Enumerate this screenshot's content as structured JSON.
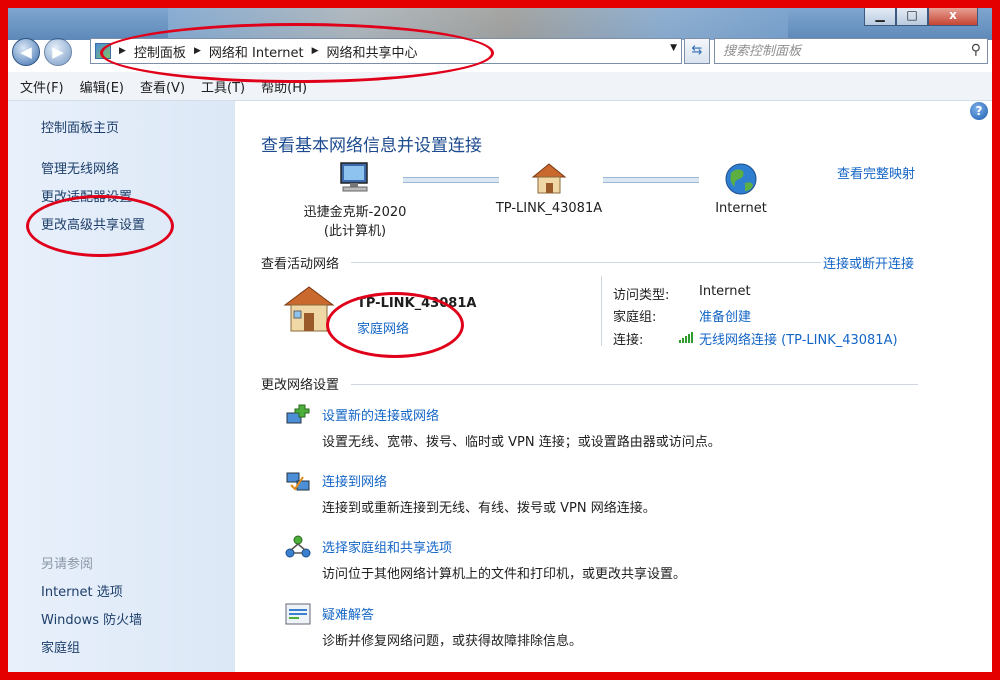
{
  "window": {
    "min_glyph": "▁",
    "max_glyph": "□",
    "close_glyph": "x"
  },
  "nav": {
    "back_glyph": "◀",
    "forward_glyph": "▶",
    "breadcrumb": [
      "控制面板",
      "网络和 Internet",
      "网络和共享中心"
    ],
    "search_placeholder": "搜索控制面板"
  },
  "menu": [
    "文件(F)",
    "编辑(E)",
    "查看(V)",
    "工具(T)",
    "帮助(H)"
  ],
  "sidebar": {
    "items": [
      "控制面板主页",
      "管理无线网络",
      "更改适配器设置",
      "更改高级共享设置"
    ],
    "see_also_title": "另请参阅",
    "see_also": [
      "Internet 选项",
      "Windows 防火墙",
      "家庭组"
    ]
  },
  "main": {
    "title": "查看基本网络信息并设置连接",
    "full_map_link": "查看完整映射",
    "map": [
      {
        "label": "迅捷金克斯-2020",
        "sublabel": "(此计算机)"
      },
      {
        "label": "TP-LINK_43081A",
        "sublabel": ""
      },
      {
        "label": "Internet",
        "sublabel": ""
      }
    ],
    "active_header": "查看活动网络",
    "connect_link": "连接或断开连接",
    "active_network": {
      "name": "TP-LINK_43081A",
      "type_link": "家庭网络",
      "access_type_label": "访问类型:",
      "access_type_value": "Internet",
      "homegroup_label": "家庭组:",
      "homegroup_value": "准备创建",
      "connection_label": "连接:",
      "connection_value": "无线网络连接 (TP-LINK_43081A)"
    },
    "change_header": "更改网络设置",
    "tasks": [
      {
        "icon": "network-setup-icon",
        "link": "设置新的连接或网络",
        "desc": "设置无线、宽带、拨号、临时或 VPN 连接；或设置路由器或访问点。"
      },
      {
        "icon": "connect-network-icon",
        "link": "连接到网络",
        "desc": "连接到或重新连接到无线、有线、拨号或 VPN 网络连接。"
      },
      {
        "icon": "homegroup-sharing-icon",
        "link": "选择家庭组和共享选项",
        "desc": "访问位于其他网络计算机上的文件和打印机，或更改共享设置。"
      },
      {
        "icon": "troubleshoot-icon",
        "link": "疑难解答",
        "desc": "诊断并修复网络问题，或获得故障排除信息。"
      }
    ]
  },
  "help_glyph": "?"
}
